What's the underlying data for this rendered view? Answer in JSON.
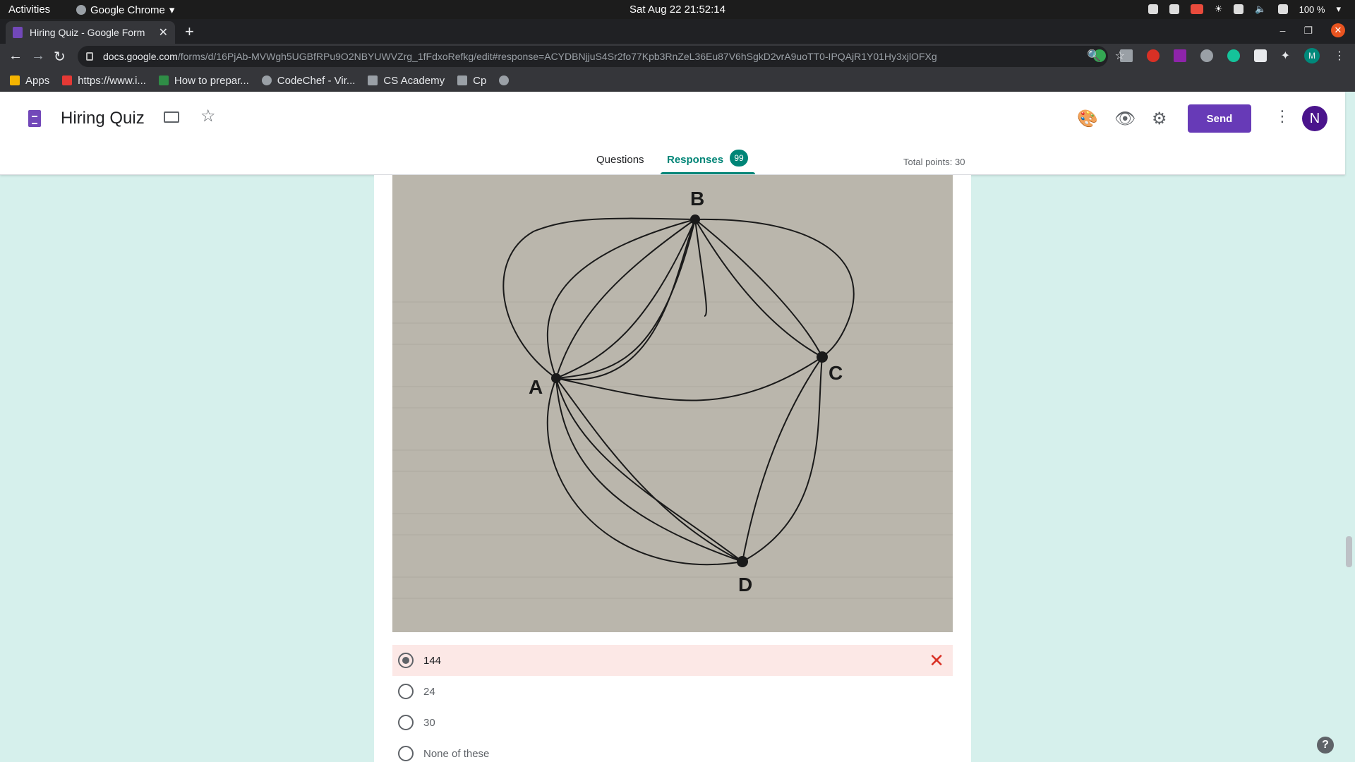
{
  "system_bar": {
    "activities": "Activities",
    "app_name": "Google Chrome",
    "clock": "Sat Aug 22  21:52:14",
    "battery": "100 %"
  },
  "browser": {
    "tab_title": "Hiring Quiz - Google Form",
    "url_host": "docs.google.com",
    "url_path": "/forms/d/16PjAb-MVWgh5UGBfRPu9O2NBYUWVZrg_1fFdxoRefkg/edit#response=ACYDBNjjuS4Sr2fo77Kpb3RnZeL36Eu87V6hSgkD2vrA9uoTT0-IPQAjR1Y01Hy3xjlOFXg",
    "extension_avatar": "M"
  },
  "bookmarks": [
    {
      "label": "Apps",
      "icon": "apps-grid-icon",
      "color": "#f4b400"
    },
    {
      "label": "https://www.i...",
      "icon": "bookmark-site-icon",
      "color": "#e53935"
    },
    {
      "label": "How to prepar...",
      "icon": "gfg-icon",
      "color": "#2f8d46"
    },
    {
      "label": "CodeChef - Vir...",
      "icon": "codechef-icon",
      "color": "#cccccc"
    },
    {
      "label": "CS Academy",
      "icon": "cs-academy-icon",
      "color": "#cccccc"
    },
    {
      "label": "Cp",
      "icon": "folder-icon",
      "color": "#cccccc"
    },
    {
      "label": "",
      "icon": "globe-icon",
      "color": "#cccccc"
    }
  ],
  "forms": {
    "title": "Hiring Quiz",
    "send_label": "Send",
    "avatar_letter": "N",
    "tab_questions": "Questions",
    "tab_responses": "Responses",
    "response_count": "99",
    "total_points": "Total points: 30",
    "accent_color": "#673ab7",
    "responses_color": "#008577"
  },
  "question": {
    "graph_labels": {
      "a": "A",
      "b": "B",
      "c": "C",
      "d": "D"
    },
    "options": [
      {
        "label": "144",
        "selected": true,
        "wrong": true
      },
      {
        "label": "24",
        "selected": false
      },
      {
        "label": "30",
        "selected": false
      },
      {
        "label": "None of these",
        "selected": false
      }
    ]
  }
}
